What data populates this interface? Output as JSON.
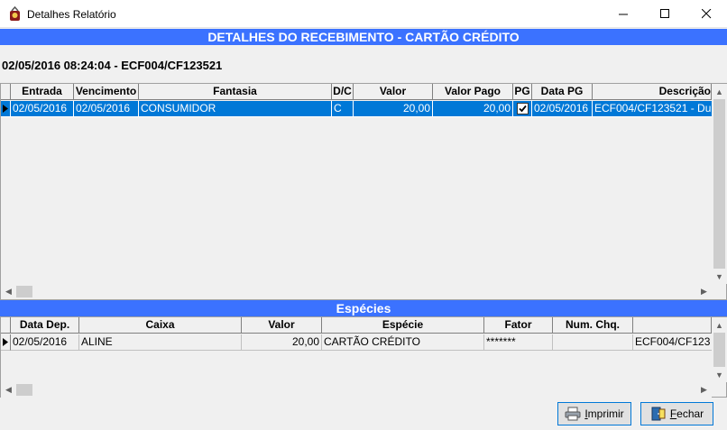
{
  "window": {
    "title": "Detalhes Relatório"
  },
  "banner_main": "DETALHES DO RECEBIMENTO - CARTÃO CRÉDITO",
  "subheader": "02/05/2016 08:24:04 - ECF004/CF123521",
  "receipts": {
    "columns": [
      "Entrada",
      "Vencimento",
      "Fantasia",
      "D/C",
      "Valor",
      "Valor Pago",
      "PG",
      "Data PG",
      "Descrição"
    ],
    "rows": [
      {
        "entrada": "02/05/2016",
        "vencimento": "02/05/2016",
        "fantasia": "CONSUMIDOR",
        "dc": "C",
        "valor": "20,00",
        "valor_pago": "20,00",
        "pg": true,
        "data_pg": "02/05/2016",
        "descricao": "ECF004/CF123521 - Du"
      }
    ]
  },
  "banner_especies": "Espécies",
  "especies": {
    "columns": [
      "Data Dep.",
      "Caixa",
      "Valor",
      "Espécie",
      "Fator",
      "Num. Chq.",
      ""
    ],
    "rows": [
      {
        "data_dep": "02/05/2016",
        "caixa": "ALINE",
        "valor": "20,00",
        "especie": "CARTÃO CRÉDITO",
        "fator": "*******",
        "num_chq": "",
        "extra": "ECF004/CF123"
      }
    ]
  },
  "buttons": {
    "imprimir": "mprimir",
    "imprimir_mnemonic": "I",
    "fechar": "echar",
    "fechar_mnemonic": "F"
  },
  "colors": {
    "banner": "#3b72ff",
    "selection": "#0078d7"
  }
}
